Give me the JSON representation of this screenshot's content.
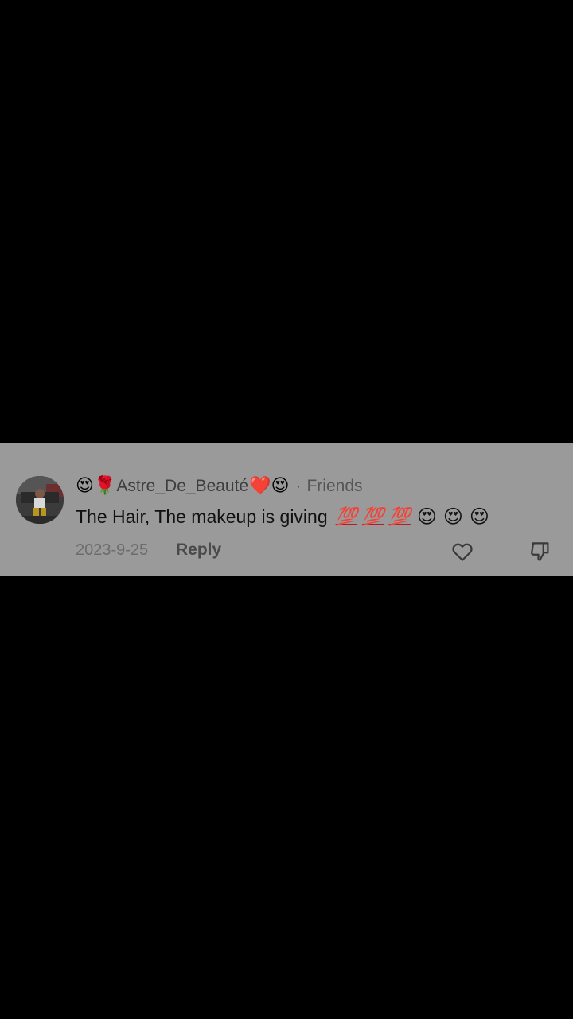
{
  "comment": {
    "avatar_icon": "user-avatar-photo",
    "header": {
      "lead_emoji_1": "😍",
      "lead_emoji_2": "🌹",
      "username": "Astre_De_Beauté",
      "trail_emoji_1": "❤️",
      "trail_emoji_2": "😍",
      "separator": "·",
      "relation": "Friends"
    },
    "text": "The Hair, The makeup is giving",
    "text_emojis": {
      "hundred_1": "💯",
      "hundred_2": "💯",
      "hundred_3": "💯",
      "heart_eyes_1": "😍",
      "heart_eyes_2": "😍",
      "heart_eyes_3": "😍"
    },
    "date": "2023-9-25",
    "reply_label": "Reply",
    "like_icon": "heart-outline-icon",
    "dislike_icon": "thumbs-down-icon"
  },
  "colors": {
    "background": "#000000",
    "card": "#9a9a9a",
    "username": "#3d3d3d",
    "meta": "#6c6c6c"
  }
}
